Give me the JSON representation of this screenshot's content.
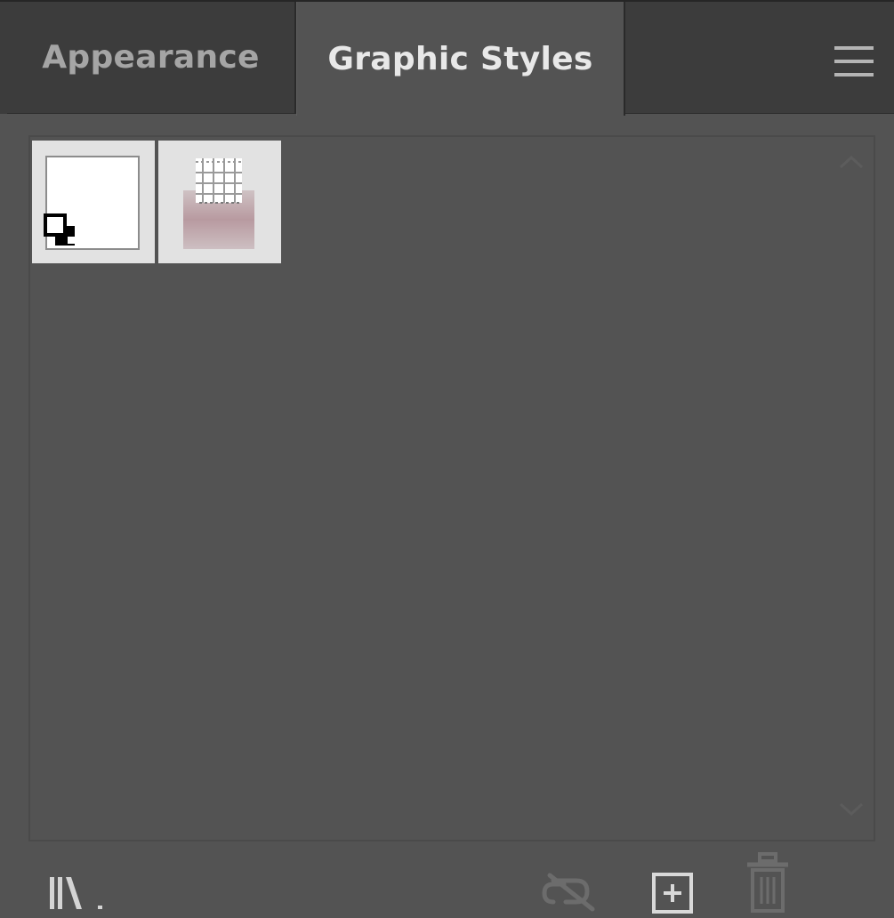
{
  "tabs": [
    {
      "label": "Appearance",
      "active": false
    },
    {
      "label": "Graphic Styles",
      "active": true
    }
  ],
  "panel_menu": {
    "icon": "hamburger-menu-icon"
  },
  "styles_list": [
    {
      "name": "default-graphic-style",
      "icon": "default-style-thumbnail"
    },
    {
      "name": "pattern-graphic-style",
      "icon": "pattern-style-thumbnail"
    }
  ],
  "footer": {
    "library_icon": "graphic-styles-libraries-menu-icon",
    "break_link_icon": "break-link-icon",
    "new_style_icon": "new-graphic-style-icon",
    "delete_icon": "trash-icon"
  },
  "colors": {
    "panel_bg": "#535353",
    "tab_bar_bg": "#3c3c3c",
    "active_tab_text": "#e8e8e8",
    "inactive_tab_text": "#a5a5a5",
    "disabled_icon": "#6c6c6c",
    "enabled_icon": "#d9d9d9"
  }
}
